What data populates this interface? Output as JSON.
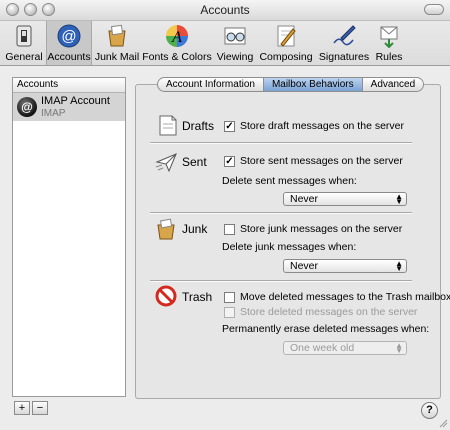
{
  "window": {
    "title": "Accounts"
  },
  "toolbar": {
    "items": [
      {
        "label": "General",
        "icon": "general-switch-icon"
      },
      {
        "label": "Accounts",
        "icon": "at-sign-icon",
        "selected": true
      },
      {
        "label": "Junk Mail",
        "icon": "junk-mail-icon"
      },
      {
        "label": "Fonts & Colors",
        "icon": "fonts-colors-icon"
      },
      {
        "label": "Viewing",
        "icon": "viewing-glasses-icon"
      },
      {
        "label": "Composing",
        "icon": "composing-pencil-icon"
      },
      {
        "label": "Signatures",
        "icon": "signatures-pen-icon"
      },
      {
        "label": "Rules",
        "icon": "rules-icon"
      }
    ]
  },
  "accounts": {
    "header": "Accounts",
    "items": [
      {
        "name": "IMAP Account",
        "type": "IMAP"
      }
    ],
    "add_label": "+",
    "remove_label": "−"
  },
  "tabs": [
    {
      "label": "Account Information",
      "active": false
    },
    {
      "label": "Mailbox Behaviors",
      "active": true
    },
    {
      "label": "Advanced",
      "active": false
    }
  ],
  "drafts": {
    "title": "Drafts",
    "store_label": "Store draft messages on the server",
    "store_checked": true
  },
  "sent": {
    "title": "Sent",
    "store_label": "Store sent messages on the server",
    "store_checked": true,
    "delete_label": "Delete sent messages when:",
    "delete_value": "Never"
  },
  "junk": {
    "title": "Junk",
    "store_label": "Store junk messages on the server",
    "store_checked": false,
    "delete_label": "Delete junk messages when:",
    "delete_value": "Never"
  },
  "trash": {
    "title": "Trash",
    "move_label": "Move deleted messages to the Trash mailbox",
    "move_checked": false,
    "store_label": "Store deleted messages on the server",
    "store_checked": false,
    "erase_label": "Permanently erase deleted messages when:",
    "erase_value": "One week old"
  },
  "help": {
    "label": "?"
  },
  "colors": {
    "selected_tab": "#7aa3d4",
    "selected_row": "#d4d4d4"
  }
}
